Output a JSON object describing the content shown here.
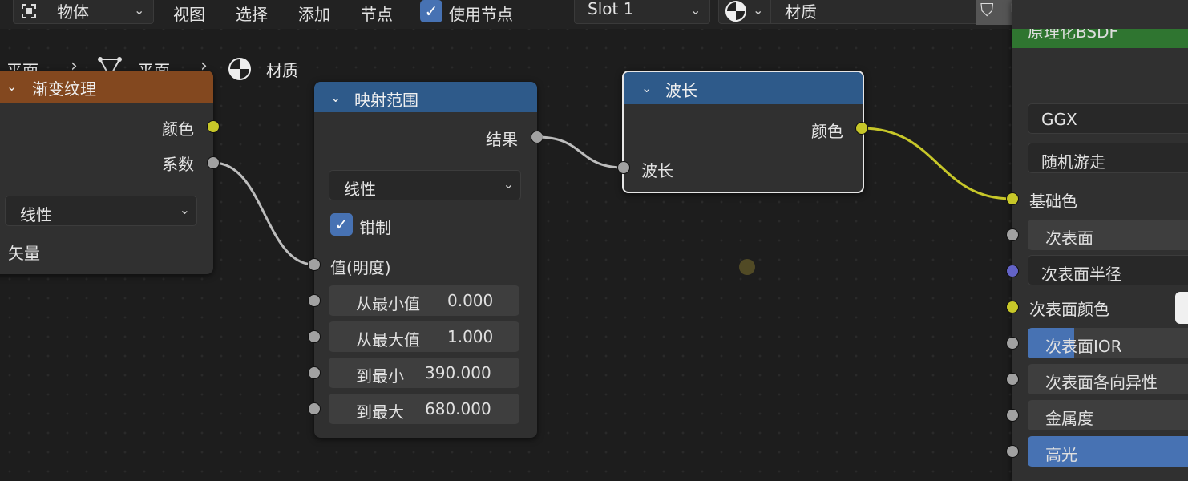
{
  "header": {
    "mode_select": "物体",
    "menu_view": "视图",
    "menu_select": "选择",
    "menu_add": "添加",
    "menu_node": "节点",
    "use_nodes_label": "使用节点",
    "slot_select": "Slot 1",
    "material_name": "材质"
  },
  "breadcrumb": {
    "item1": "平面",
    "item2": "平面",
    "item3": "材质"
  },
  "nodes": {
    "gradient": {
      "title": "渐变纹理",
      "out_color": "颜色",
      "out_factor": "系数",
      "type_select": "线性",
      "vector": "矢量"
    },
    "map_range": {
      "title": "映射范围",
      "out_result": "结果",
      "interp_select": "线性",
      "clamp_label": "钳制",
      "in_value": "值(明度)",
      "from_min_label": "从最小值",
      "from_min_value": "0.000",
      "from_max_label": "从最大值",
      "from_max_value": "1.000",
      "to_min_label": "到最小",
      "to_min_value": "390.000",
      "to_max_label": "到最大",
      "to_max_value": "680.000"
    },
    "wavelength": {
      "title": "波长",
      "out_color": "颜色",
      "in_wavelength": "波长"
    },
    "bsdf": {
      "title": "原理化BSDF",
      "distribution": "GGX",
      "subsurface_method": "随机游走",
      "base_color": "基础色",
      "subsurface": "次表面",
      "subsurface_radius": "次表面半径",
      "subsurface_color": "次表面颜色",
      "subsurface_ior": "次表面IOR",
      "subsurface_anisotropy": "次表面各向异性",
      "metallic": "金属度",
      "specular": "高光"
    }
  },
  "colors": {
    "texture_header": "#83481f",
    "converter_header": "#2e5a8a",
    "shader_header": "#2f7530",
    "socket_yellow": "#c7c729",
    "socket_grey": "#a1a1a1",
    "socket_blue": "#6363c7",
    "accent": "#4772b3"
  }
}
